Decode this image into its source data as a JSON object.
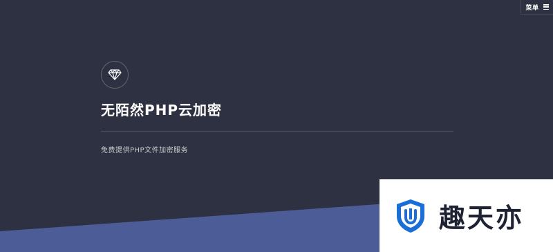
{
  "header": {
    "menu_label": "菜单"
  },
  "hero": {
    "icon": "diamond-icon",
    "title": "无陌然PHP云加密",
    "subtitle": "免费提供PHP文件加密服务"
  },
  "watermark": {
    "icon": "shield-logo-icon",
    "text": "趣天亦"
  },
  "colors": {
    "background": "#2e3141",
    "band": "#4c5c96",
    "logo_blue": "#1a6fd6",
    "watermark_bg": "#ffffff"
  }
}
